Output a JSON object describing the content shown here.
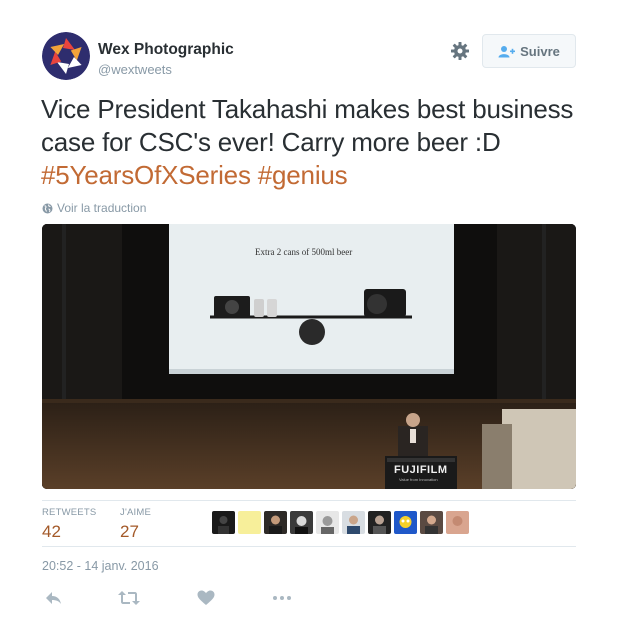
{
  "account": {
    "display_name": "Wex Photographic",
    "handle": "@wextweets",
    "avatar_icon": "aperture-logo-icon",
    "brand_color": "#2e2d6e"
  },
  "header": {
    "settings_icon": "gear-icon",
    "follow_button_label": "Suivre",
    "follow_icon": "add-user-icon"
  },
  "tweet": {
    "text_plain": "Vice President Takahashi makes best business case for CSC's ever! Carry more beer :D",
    "hashtags": [
      "#5YearsOfXSeries",
      "#genius"
    ],
    "translate_label": "Voir la traduction",
    "hashtag_color": "#c26a34"
  },
  "media": {
    "slide_caption": "Extra 2 cans of 500ml beer",
    "podium_brand": "FUJIFILM",
    "podium_tagline": "Value from Innovation"
  },
  "stats": {
    "retweets_label": "RETWEETS",
    "retweets_count": "42",
    "likes_label": "J'AIME",
    "likes_count": "27",
    "liker_avatars_count": 10
  },
  "timestamp": "20:52 - 14 janv. 2016",
  "actions": [
    "reply-icon",
    "retweet-icon",
    "like-icon",
    "more-icon"
  ]
}
